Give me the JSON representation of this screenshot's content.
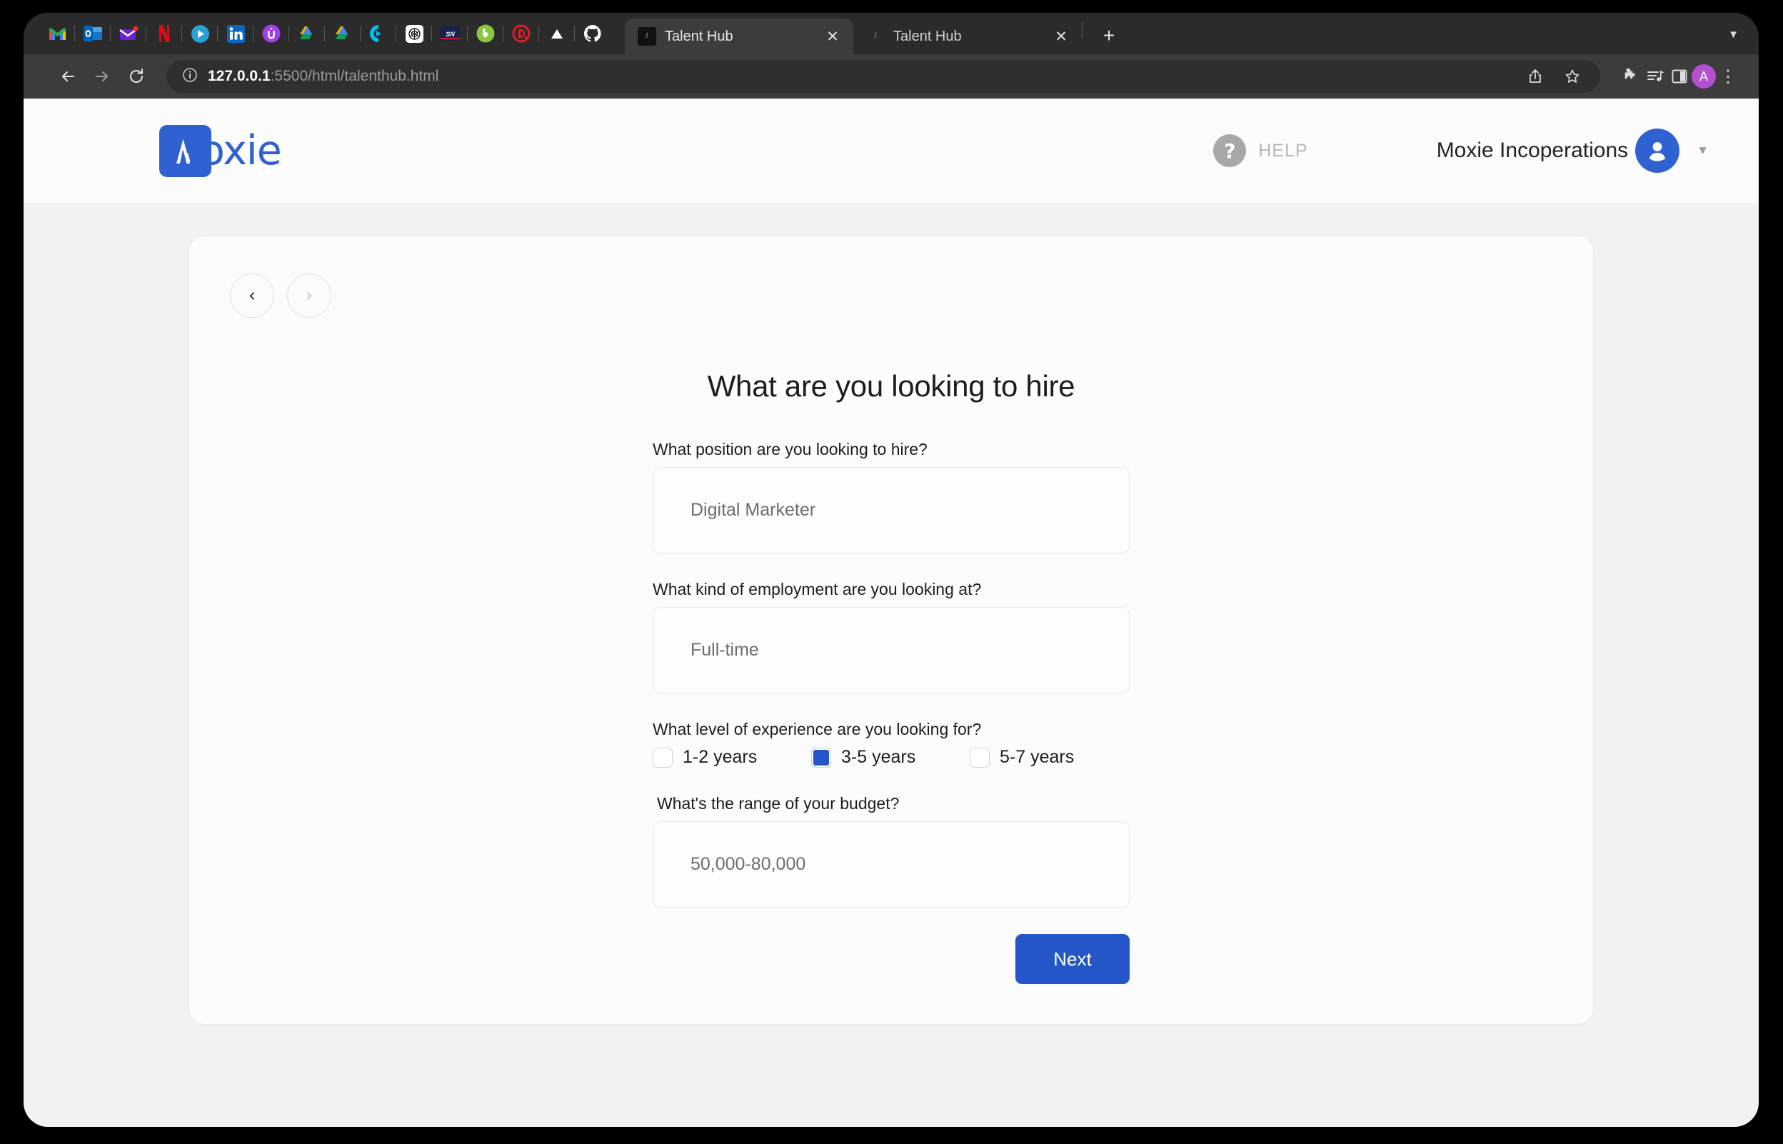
{
  "browser": {
    "bookmarks": [
      {
        "name": "gmail-bookmark",
        "label": "M"
      },
      {
        "name": "outlook-bookmark",
        "label": "O"
      },
      {
        "name": "mail-bookmark",
        "label": "✉"
      },
      {
        "name": "netflix-bookmark",
        "label": "N"
      },
      {
        "name": "play-bookmark",
        "label": "▶"
      },
      {
        "name": "linkedin-bookmark",
        "label": "in"
      },
      {
        "name": "u-app-bookmark",
        "label": "û"
      },
      {
        "name": "google-drive-bookmark",
        "label": "▲"
      },
      {
        "name": "google-drive-2-bookmark",
        "label": "▲"
      },
      {
        "name": "c-app-bookmark",
        "label": "C"
      },
      {
        "name": "openai-bookmark",
        "label": "◎"
      },
      {
        "name": "sportsnet-bookmark",
        "label": "SN"
      },
      {
        "name": "green-app-bookmark",
        "label": "b"
      },
      {
        "name": "d-app-bookmark",
        "label": "D"
      },
      {
        "name": "vercel-bookmark",
        "label": "▲"
      },
      {
        "name": "github-bookmark",
        "label": "◯"
      }
    ],
    "tabs": [
      {
        "title": "Talent Hub",
        "favicon": "ᶴ",
        "active": true,
        "close": "✕"
      },
      {
        "title": "Talent Hub",
        "favicon": "ᶴ",
        "active": false,
        "close": "✕"
      }
    ],
    "new_tab_label": "+",
    "tab_list_chevron": "▼",
    "nav": {
      "back": "←",
      "forward": "→",
      "reload": "⟳"
    },
    "omnibox": {
      "info_icon": "ⓘ",
      "url_host": "127.0.0.1",
      "url_path": ":5500/html/talenthub.html",
      "share_icon": "⤴",
      "bookmark_icon": "☆"
    },
    "toolbar_icons": {
      "extensions": "🧩",
      "media": "≡♪",
      "side_panel": "▣",
      "profile_initial": "A",
      "menu": "⋮"
    }
  },
  "app": {
    "logo": {
      "mark": "M",
      "word": "oxie"
    },
    "help": {
      "icon": "?",
      "label": "HELP"
    },
    "org": {
      "name": "Moxie Incoperations",
      "caret": "▼"
    }
  },
  "card": {
    "pager": {
      "prev": "‹",
      "next": "›"
    },
    "form": {
      "title": "What are you looking to hire",
      "fields": [
        {
          "name": "position",
          "label": "What position are you looking to hire?",
          "value": "Digital Marketer"
        },
        {
          "name": "employment",
          "label": "What kind of employment are you looking at?",
          "value": "Full-time"
        }
      ],
      "experience": {
        "label": "What level of experience are you looking for?",
        "options": [
          {
            "label": "1-2 years",
            "checked": false
          },
          {
            "label": "3-5 years",
            "checked": true
          },
          {
            "label": "5-7 years",
            "checked": false
          }
        ]
      },
      "budget": {
        "label": "What's the range of your budget?",
        "value": "50,000-80,000"
      },
      "submit_label": "Next"
    }
  },
  "colors": {
    "brand_blue": "#2556c7",
    "logo_blue": "#2f62d0",
    "page_bg": "#f2f2f2",
    "card_bg": "#fcfcfc",
    "chrome_dark": "#2b2b2b"
  }
}
